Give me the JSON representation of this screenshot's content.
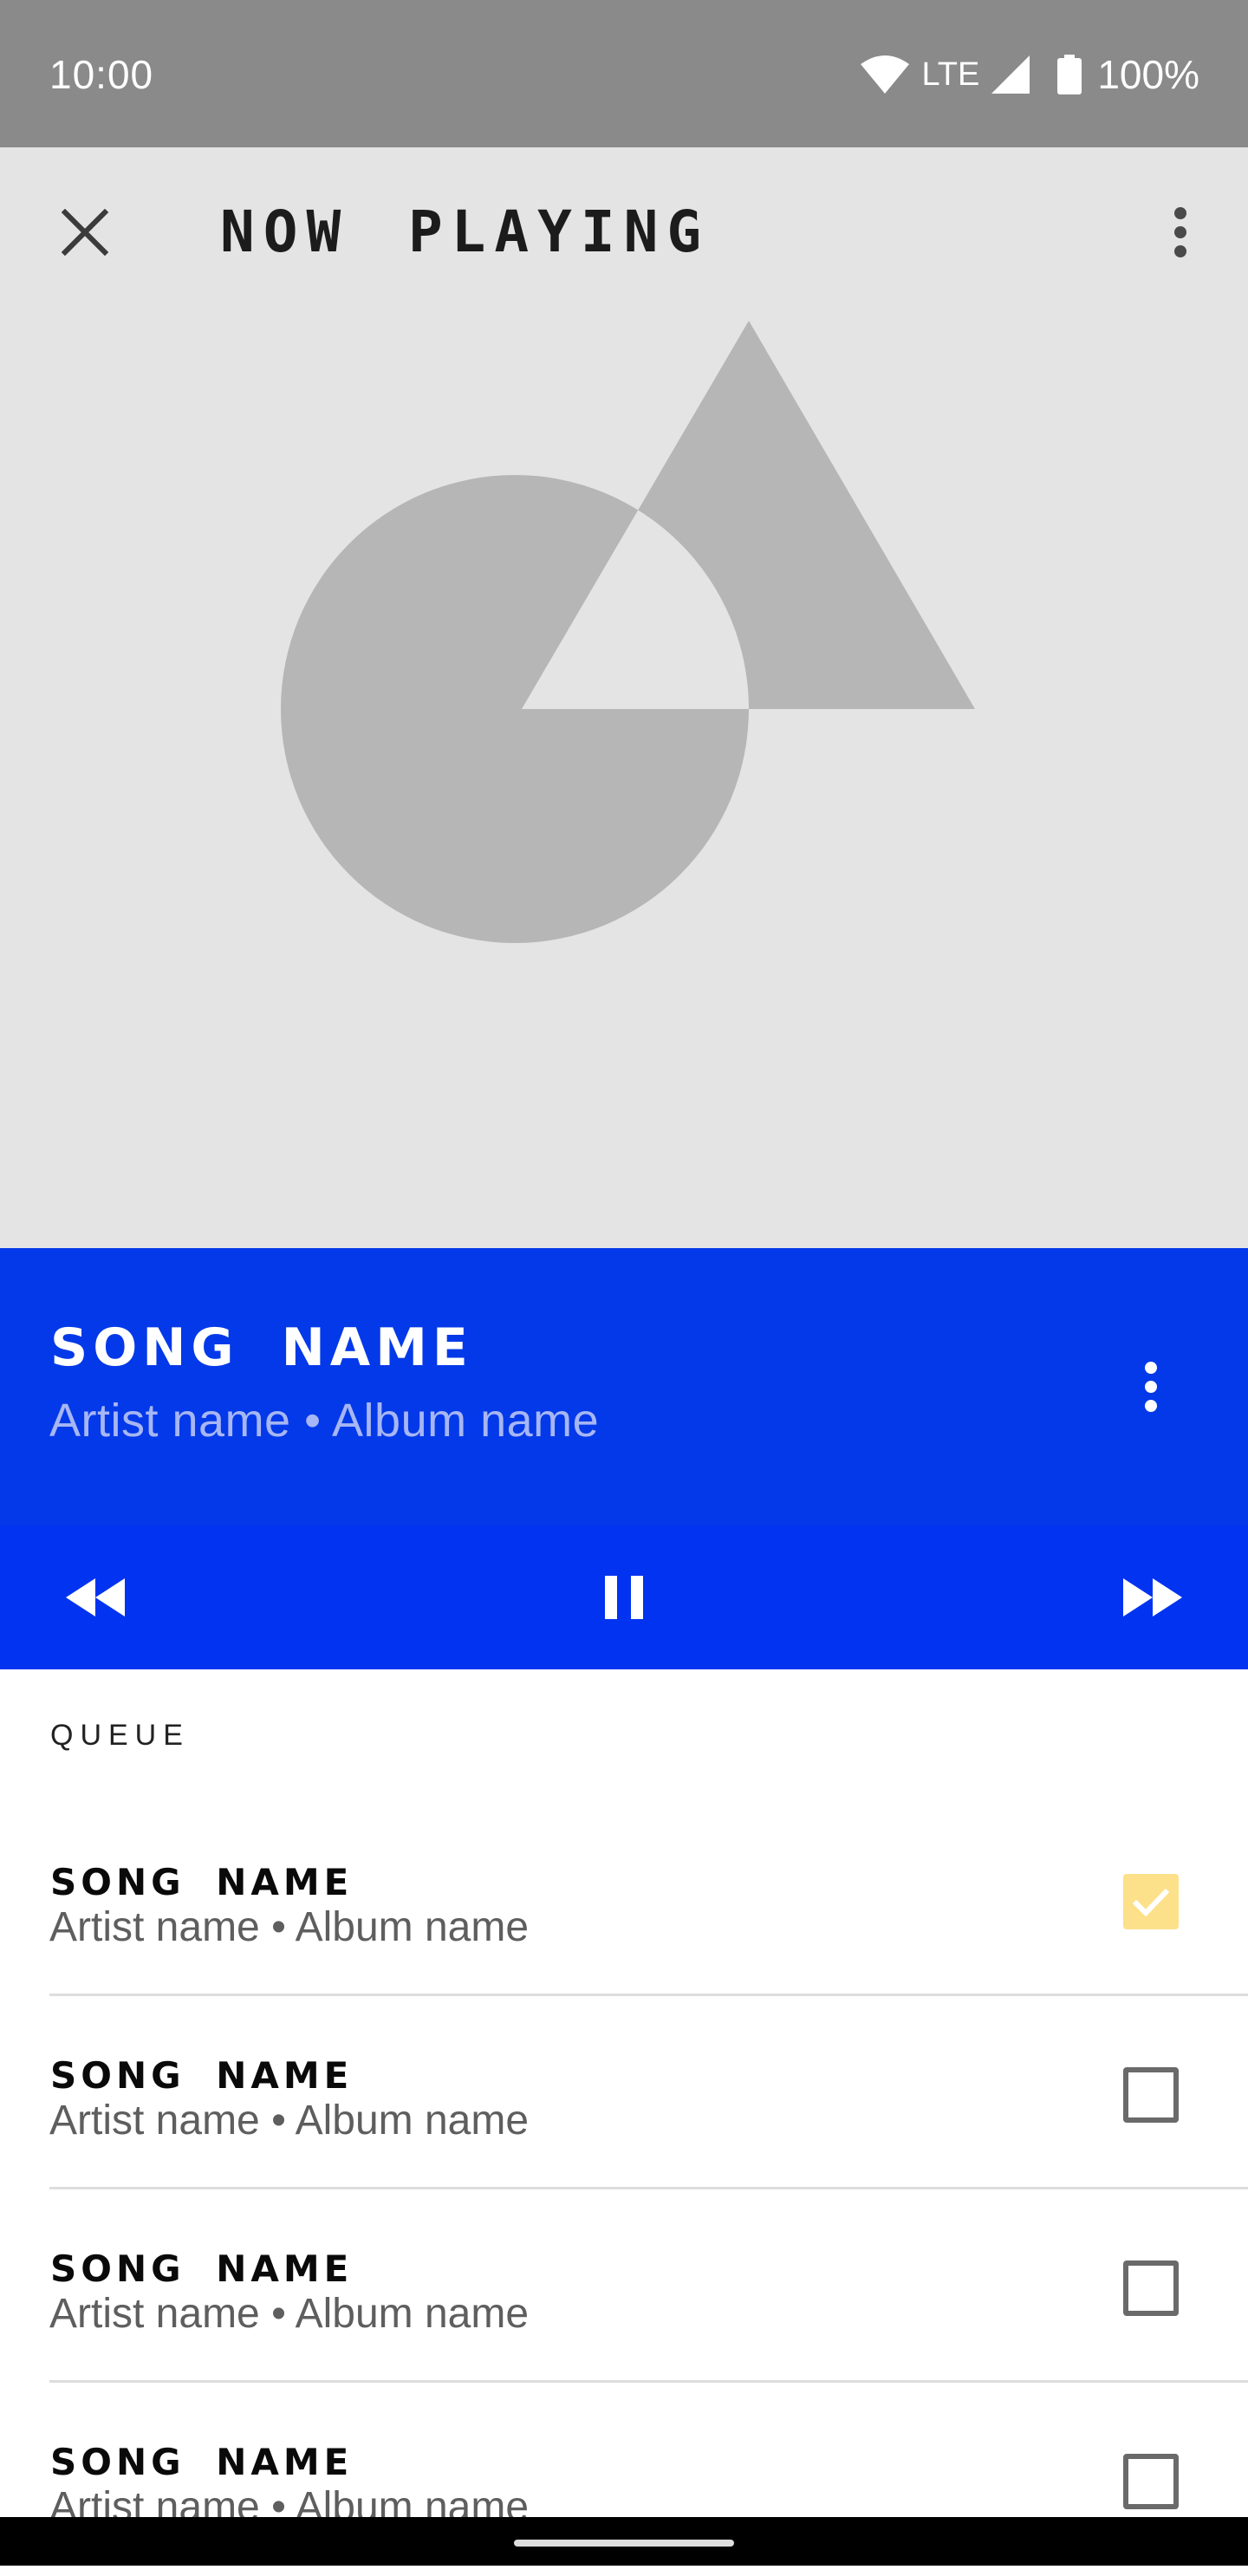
{
  "status_bar": {
    "time": "10:00",
    "network": "LTE",
    "battery": "100%",
    "icons": [
      "wifi-icon",
      "signal-icon",
      "battery-icon"
    ]
  },
  "header": {
    "title": "NOW PLAYING",
    "close_icon": "close-icon",
    "menu_icon": "more-vert-icon"
  },
  "now_playing": {
    "song": "SONG NAME",
    "subtitle": "Artist name • Album name",
    "menu_icon": "more-vert-icon"
  },
  "controls": {
    "icons": [
      "rewind-icon",
      "pause-icon",
      "fast-forward-icon"
    ]
  },
  "queue": {
    "label": "QUEUE",
    "items": [
      {
        "title": "SONG NAME",
        "subtitle": "Artist name • Album name",
        "checked": true
      },
      {
        "title": "SONG NAME",
        "subtitle": "Artist name • Album name",
        "checked": false
      },
      {
        "title": "SONG NAME",
        "subtitle": "Artist name • Album name",
        "checked": false
      },
      {
        "title": "SONG NAME",
        "subtitle": "Artist name • Album name",
        "checked": false
      }
    ]
  },
  "colors": {
    "primary_blue": "#0339e8",
    "controls_blue": "#0133f0",
    "art_background": "#e4e4e4",
    "art_shapes": "#b6b6b6",
    "checkbox_checked": "#fde08a",
    "status_bar": "#8a8a8a"
  }
}
